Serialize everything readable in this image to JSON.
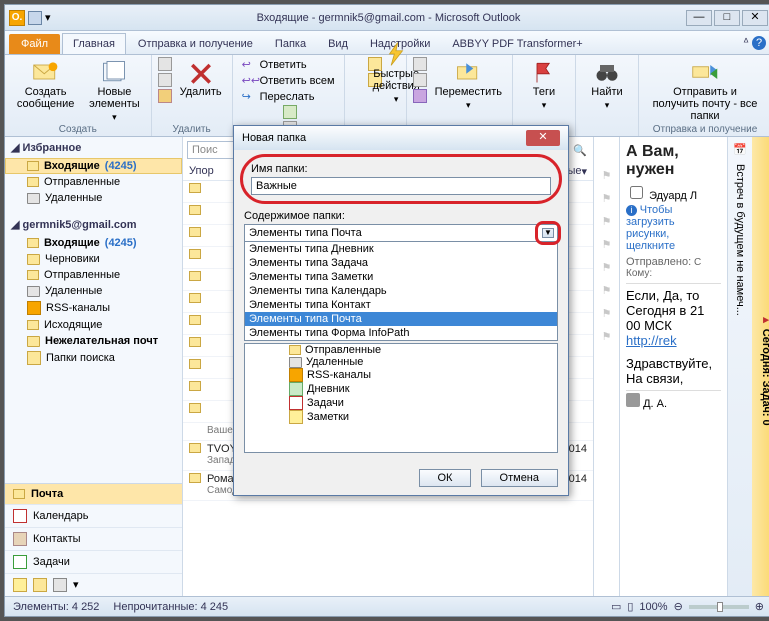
{
  "window_title": "Входящие - germnik5@gmail.com - Microsoft Outlook",
  "file_tab": "Файл",
  "tabs": [
    "Главная",
    "Отправка и получение",
    "Папка",
    "Вид",
    "Надстройки",
    "ABBYY PDF Transformer+"
  ],
  "ribbon": {
    "new_msg": "Создать сообщение",
    "new_items": "Новые элементы",
    "delete": "Удалить",
    "reply": "Ответить",
    "reply_all": "Ответить всем",
    "forward": "Переслать",
    "quick_actions": "Быстрые действия",
    "move": "Переместить",
    "tags": "Теги",
    "find": "Найти",
    "send_receive": "Отправить и получить почту - все папки",
    "grp_create": "Создать",
    "grp_delete": "Удалить",
    "grp_sendrecv": "Отправка и получение"
  },
  "nav": {
    "fav": "Избранное",
    "inbox": "Входящие",
    "inbox_count": "(4245)",
    "sent": "Отправленные",
    "deleted": "Удаленные",
    "account": "germnik5@gmail.com",
    "drafts": "Черновики",
    "rss": "RSS-каналы",
    "outbox": "Исходящие",
    "junk": "Нежелательная почт",
    "search": "Папки поиска",
    "mod_mail": "Почта",
    "mod_cal": "Календарь",
    "mod_contacts": "Контакты",
    "mod_tasks": "Задачи"
  },
  "mid": {
    "search_ph": "Поис",
    "arrange": "Упор",
    "arrange_r": "вые",
    "m1_from": "Ваше время уходит.",
    "m2_from": "TVOY BUSINESS.RU",
    "m2_sub": "Западный сервис платит больше!",
    "m2_date": "05.03.2014",
    "m3_from": "Роман Когай",
    "m3_sub": "Самодисциплина для диабетиков.",
    "m3_date": "05.03.2014"
  },
  "reading": {
    "hdr": "А Вам, нужен",
    "from": "Эдуард Л",
    "note": "Чтобы загрузить рисунки, щелкните",
    "sent_lbl": "Отправлено:",
    "to_lbl": "Кому:",
    "body1": "Если, Да, то Сегодня в 21 00 МСК",
    "link": "http://rek",
    "body2": "Здравствуйте, На связи,",
    "footer_da": "Д. А."
  },
  "today_bar": "Сегодня: Задач: 0",
  "todo_bar": "Встреч в будущем не намеч...",
  "status": {
    "items": "Элементы: 4 252",
    "unread": "Непрочитанные: 4 245",
    "zoom": "100%"
  },
  "dialog": {
    "title": "Новая папка",
    "name_lbl": "Имя папки:",
    "name_val": "Важные",
    "content_lbl": "Содержимое папки:",
    "combo_val": "Элементы типа Почта",
    "options": [
      "Элементы типа Дневник",
      "Элементы типа Задача",
      "Элементы типа Заметки",
      "Элементы типа Календарь",
      "Элементы типа Контакт",
      "Элементы типа Почта",
      "Элементы типа Форма InfoPath"
    ],
    "tree": [
      "Отправленные",
      "Удаленные",
      "RSS-каналы",
      "Дневник",
      "Задачи",
      "Заметки"
    ],
    "ok": "ОК",
    "cancel": "Отмена"
  }
}
